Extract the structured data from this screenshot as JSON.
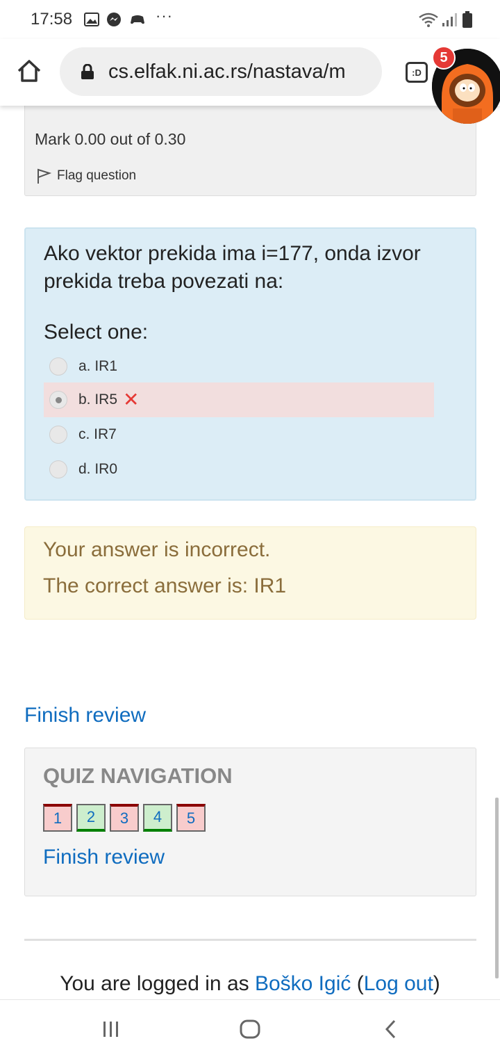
{
  "status_bar": {
    "time": "17:58",
    "overflow": "···"
  },
  "browser": {
    "url": "cs.elfak.ni.ac.rs/nastava/m",
    "tab_label": ":D",
    "badge_count": "5"
  },
  "question_prev": {
    "mark": "Mark 0.00 out of 0.30",
    "flag_label": "Flag question"
  },
  "question": {
    "text": "Ako vektor prekida ima i=177, onda izvor prekida treba povezati na:",
    "select_prompt": "Select one:",
    "options": [
      {
        "label": "a. IR1",
        "selected": false
      },
      {
        "label": "b. IR5",
        "selected": true,
        "incorrect": true
      },
      {
        "label": "c. IR7",
        "selected": false
      },
      {
        "label": "d. IR0",
        "selected": false
      }
    ]
  },
  "feedback": {
    "line1": "Your answer is incorrect.",
    "line2": "The correct answer is: IR1"
  },
  "finish_review": "Finish review",
  "quiz_navigation": {
    "title": "QUIZ NAVIGATION",
    "buttons": [
      {
        "label": "1",
        "state": "incorrect"
      },
      {
        "label": "2",
        "state": "correct"
      },
      {
        "label": "3",
        "state": "incorrect"
      },
      {
        "label": "4",
        "state": "correct"
      },
      {
        "label": "5",
        "state": "incorrect"
      }
    ],
    "finish_label": "Finish review"
  },
  "footer": {
    "prefix": "You are logged in as ",
    "user": "Boško Igić",
    "open_paren": " (",
    "logout": "Log out",
    "close_paren": ")"
  },
  "colors": {
    "link": "#0f6cbf",
    "question_bg": "#dcedf6",
    "feedback_bg": "#fcf8e3",
    "incorrect_bg": "#f2dede",
    "badge": "#e53935"
  }
}
